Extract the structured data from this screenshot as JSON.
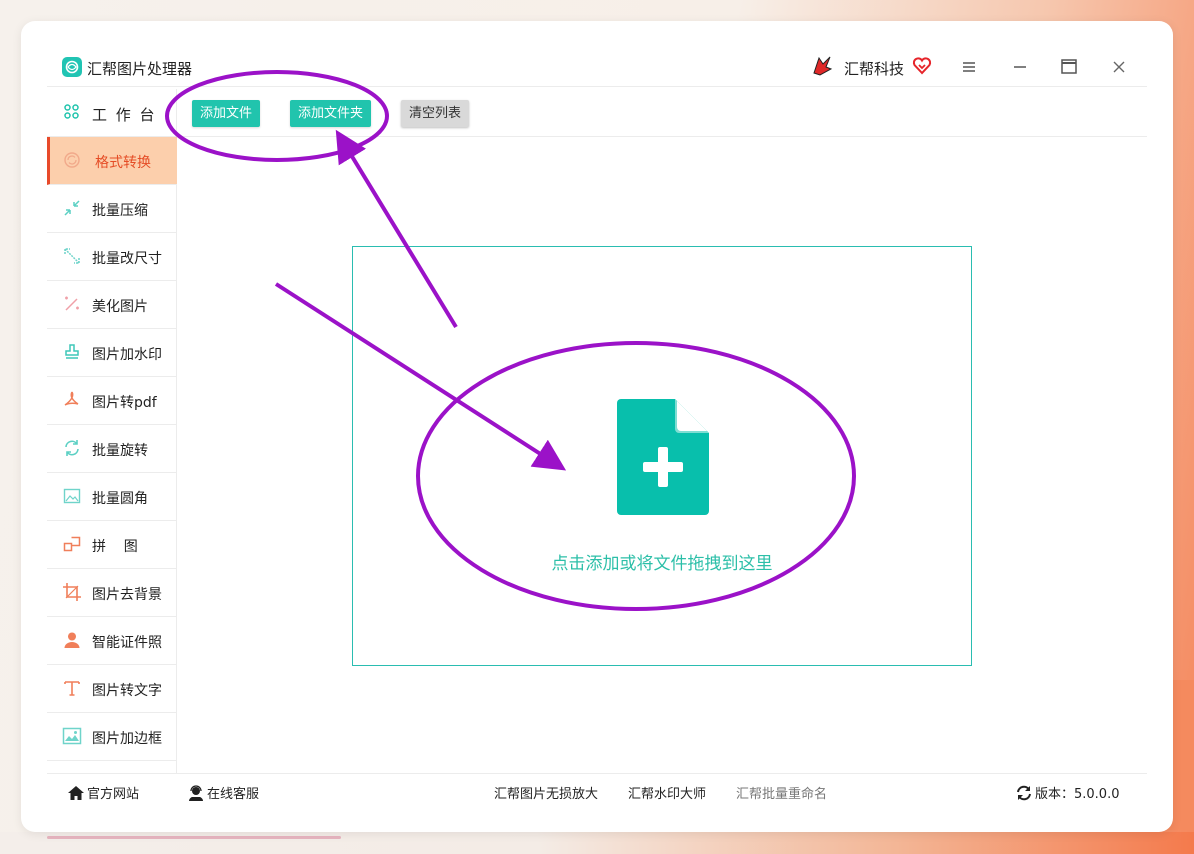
{
  "app": {
    "title": "汇帮图片处理器",
    "brand": "汇帮科技"
  },
  "sidebar": {
    "items": [
      {
        "label": "工 作 台",
        "icon": "grid-icon"
      },
      {
        "label": "格式转换",
        "icon": "convert-icon"
      },
      {
        "label": "批量压缩",
        "icon": "compress-icon"
      },
      {
        "label": "批量改尺寸",
        "icon": "resize-icon"
      },
      {
        "label": "美化图片",
        "icon": "beautify-icon"
      },
      {
        "label": "图片加水印",
        "icon": "watermark-icon"
      },
      {
        "label": "图片转pdf",
        "icon": "pdf-icon"
      },
      {
        "label": "批量旋转",
        "icon": "rotate-icon"
      },
      {
        "label": "批量圆角",
        "icon": "round-corner-icon"
      },
      {
        "label": "拼    图",
        "icon": "puzzle-icon"
      },
      {
        "label": "图片去背景",
        "icon": "crop-icon"
      },
      {
        "label": "智能证件照",
        "icon": "person-icon"
      },
      {
        "label": "图片转文字",
        "icon": "text-icon"
      },
      {
        "label": "图片加边框",
        "icon": "frame-icon"
      }
    ],
    "active_index": 1
  },
  "toolbar": {
    "add_file": "添加文件",
    "add_folder": "添加文件夹",
    "clear_list": "清空列表"
  },
  "dropzone": {
    "hint": "点击添加或将文件拖拽到这里"
  },
  "footer": {
    "website": "官方网站",
    "support": "在线客服",
    "link1": "汇帮图片无损放大",
    "link2": "汇帮水印大师",
    "link3": "汇帮批量重命名",
    "version": "版本：5.0.0.0"
  },
  "colors": {
    "accent": "#21c4ad",
    "active_bg": "#fccfac",
    "active_text": "#e54d26",
    "annotation": "#9b12c8"
  }
}
